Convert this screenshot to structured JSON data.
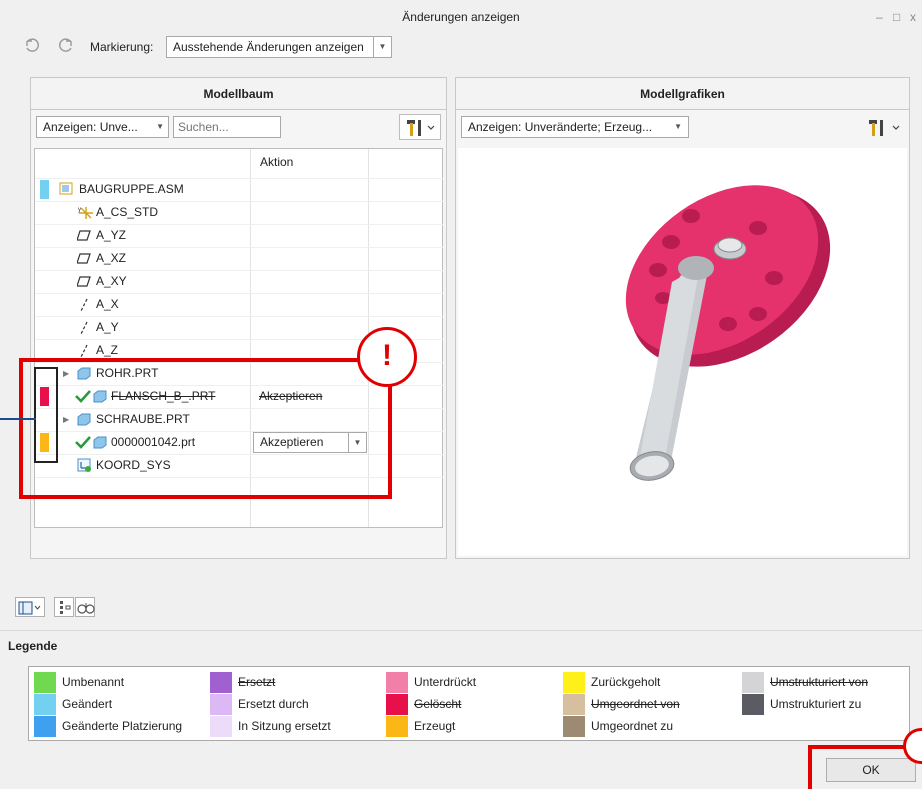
{
  "window": {
    "title": "Änderungen anzeigen",
    "controls": [
      "–",
      "□",
      "x"
    ]
  },
  "toolbar": {
    "marking_label": "Markierung:",
    "marking_value": "Ausstehende Änderungen anzeigen"
  },
  "modelltree": {
    "header": "Modellbaum",
    "filter_value": "Anzeigen: Unve...",
    "search_placeholder": "Suchen...",
    "col_action": "Aktion",
    "items": [
      {
        "label": "BAUGRUPPE.ASM"
      },
      {
        "label": "A_CS_STD"
      },
      {
        "label": "A_YZ"
      },
      {
        "label": "A_XZ"
      },
      {
        "label": "A_XY"
      },
      {
        "label": "A_X"
      },
      {
        "label": "A_Y"
      },
      {
        "label": "A_Z"
      },
      {
        "label": "ROHR.PRT"
      },
      {
        "label": "FLANSCH_B_.PRT",
        "action": "Akzeptieren"
      },
      {
        "label": "SCHRAUBE.PRT"
      },
      {
        "label": "0000001042.prt",
        "action": "Akzeptieren"
      },
      {
        "label": "KOORD_SYS"
      }
    ]
  },
  "graphics": {
    "header": "Modellgrafiken",
    "filter_value": "Anzeigen: Unveränderte; Erzeug..."
  },
  "callout": {
    "symbol": "!"
  },
  "legend": {
    "title": "Legende",
    "items": [
      {
        "label": "Umbenannt",
        "color": "#70d94f"
      },
      {
        "label": "Geändert",
        "color": "#74d0f1"
      },
      {
        "label": "Geänderte Platzierung",
        "color": "#3fa0f0"
      },
      {
        "label": "Ersetzt",
        "color": "#a060d0"
      },
      {
        "label": "Ersetzt durch",
        "color": "#dcb8f5"
      },
      {
        "label": "In Sitzung ersetzt",
        "color": "#ecdcfa"
      },
      {
        "label": "Unterdrückt",
        "color": "#f27fa8"
      },
      {
        "label": "Gelöscht",
        "color": "#e8104a"
      },
      {
        "label": "Erzeugt",
        "color": "#fbb715"
      },
      {
        "label": "Zurückgeholt",
        "color": "#fef018"
      },
      {
        "label": "Umgeordnet von",
        "color": "#d5bf9f"
      },
      {
        "label": "Umgeordnet zu",
        "color": "#9c8a72"
      },
      {
        "label": "Umstrukturiert von",
        "color": "#d4d4d6"
      },
      {
        "label": "Umstrukturiert zu",
        "color": "#5a5b63"
      }
    ]
  },
  "buttons": {
    "ok": "OK"
  },
  "colors": {
    "accent_red": "#e00000",
    "flange": "#e5326c",
    "pipe": "#c8ccd0"
  }
}
